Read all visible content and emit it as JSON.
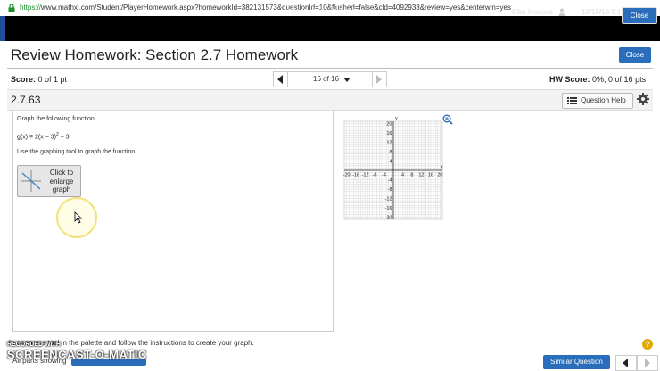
{
  "browser": {
    "url_protocol": "https://",
    "url_rest": "www.mathxl.com/Student/PlayerHomework.aspx?homeworkId=382131573&questionId=10&flushed=false&cld=4092933&review=yes&centerwin=yes"
  },
  "header": {
    "course": "MAC1105, F16, #216425, Online",
    "user": "Elka Ivanova",
    "datetime": "10/18/16 5:16 PM",
    "close_label": "Close"
  },
  "page": {
    "title": "Review Homework: Section 2.7 Homework",
    "close_label": "Close"
  },
  "score": {
    "label": "Score:",
    "value": "0 of 1 pt",
    "hw_label": "HW Score:",
    "hw_value": "0%, 0 of 16 pts"
  },
  "navigation": {
    "position": "16 of 16"
  },
  "question": {
    "id": "2.7.63",
    "help_label": "Question Help",
    "instruction": "Graph the following function.",
    "function_base": "g(x) = 2(x − 3)",
    "function_exp": "2",
    "function_tail": " − 3",
    "tool_instruction": "Use the graphing tool to graph the function.",
    "enlarge_label": "Click to enlarge graph"
  },
  "graph": {
    "x_ticks": [
      "-20",
      "-16",
      "-12",
      "-8",
      "-4",
      "4",
      "8",
      "12",
      "16",
      "20"
    ],
    "y_ticks": [
      "20",
      "16",
      "12",
      "8",
      "4",
      "-4",
      "-8",
      "-12",
      "-16",
      "-20"
    ],
    "x_axis_label": "x",
    "y_axis_label": "y"
  },
  "footer": {
    "instruction": "h, choose a tool in the palette and follow the instructions to create your graph.",
    "all_parts": "All parts showing",
    "similar_label": "Similar Question",
    "help_mark": "?"
  },
  "watermark": {
    "line1": "RECORDED WITH",
    "line2": "SCREENCAST-O-MATIC"
  },
  "colors": {
    "primary_button": "#2a6ebb",
    "header_bg": "#000000",
    "url_protocol": "#1a8f2a",
    "help_circle": "#e0a800"
  }
}
